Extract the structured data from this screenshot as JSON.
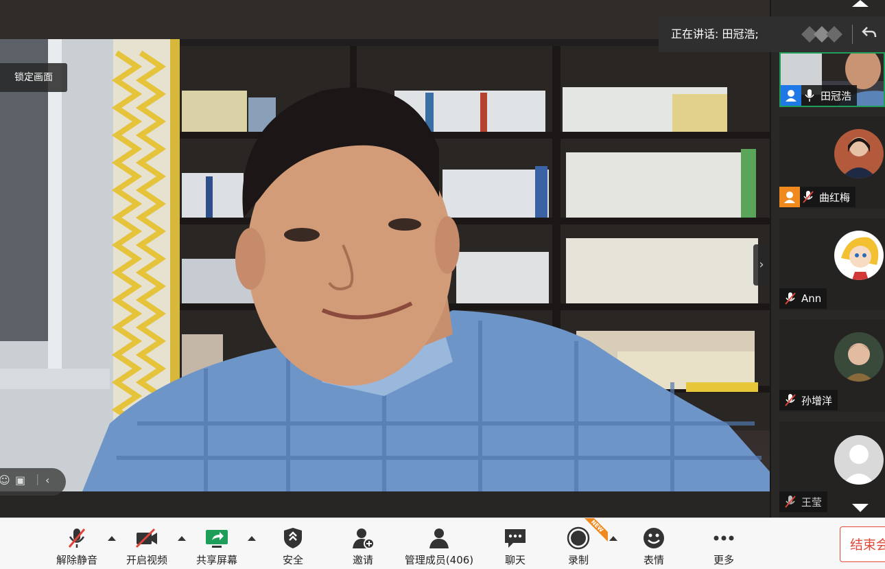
{
  "main_video": {
    "lock_label": "锁定画面"
  },
  "speaking_banner": {
    "text": "正在讲话: 田冠浩;",
    "back_icon": "undo-arrow-icon"
  },
  "participants": [
    {
      "name": "田冠浩",
      "role_badge": "host-badge",
      "badge_color": "#1e78e6",
      "mic": "mic-on-icon",
      "active": true
    },
    {
      "name": "曲红梅",
      "role_badge": "co-host-badge",
      "badge_color": "#f08a1e",
      "mic": "mic-muted-icon"
    },
    {
      "name": "Ann",
      "mic": "mic-muted-icon"
    },
    {
      "name": "孙增洋",
      "mic": "mic-muted-icon"
    },
    {
      "name": "王莹",
      "mic": "mic-muted-icon"
    }
  ],
  "toolbar": {
    "unmute": "解除静音",
    "start_video": "开启视频",
    "share_screen": "共享屏幕",
    "security": "安全",
    "invite": "邀请",
    "manage_participants": "管理成员(406)",
    "chat": "聊天",
    "record": "录制",
    "record_tag": "NEW",
    "reactions": "表情",
    "more": "更多",
    "end_meeting": "结束会议"
  },
  "colors": {
    "accent_green": "#1f9e5a",
    "end_red": "#e04a3a",
    "muted_red": "#e0433a"
  }
}
